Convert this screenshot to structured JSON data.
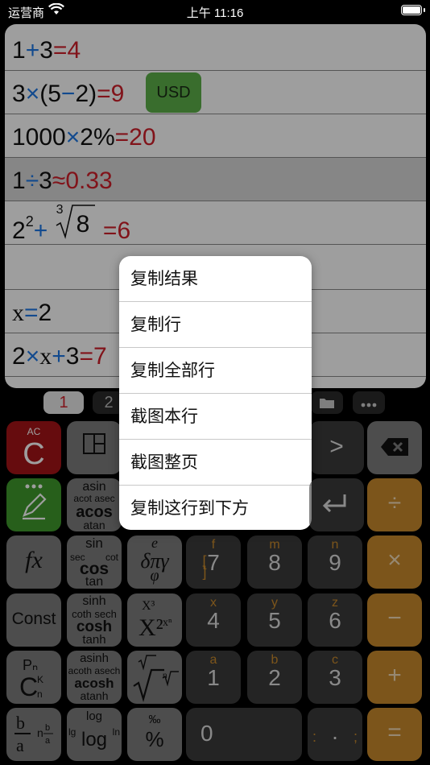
{
  "status": {
    "carrier": "运营商",
    "time": "上午 11:16"
  },
  "lines": [
    {
      "parts": [
        "1",
        "+",
        "3",
        "=",
        "4"
      ]
    },
    {
      "parts": [
        "3",
        "×",
        "(5",
        "−",
        "2)",
        "=",
        "9"
      ],
      "badge": "USD"
    },
    {
      "parts": [
        "1000",
        "×",
        "2%",
        "=",
        "20"
      ]
    },
    {
      "parts": [
        "1",
        "÷",
        "3",
        "≈",
        "0.33"
      ],
      "highlight": true
    },
    {
      "parts": [
        "2",
        "2",
        "+",
        "3",
        "8",
        "=",
        "6"
      ]
    },
    {
      "parts": []
    },
    {
      "parts": [
        "x",
        "=",
        "2"
      ]
    },
    {
      "parts": [
        "2",
        "×",
        "x",
        "+",
        "3",
        "=",
        "7"
      ]
    }
  ],
  "tabs": {
    "active": "1",
    "second": "2"
  },
  "menu": {
    "items": [
      "复制结果",
      "复制行",
      "复制全部行",
      "截图本行",
      "截图整页",
      "复制这行到下方"
    ]
  },
  "keys": {
    "ac": {
      "small": "AC",
      "main": "C"
    },
    "asin": {
      "top": "asin",
      "mid": "acot asec",
      "main": "acos",
      "bot": "atan"
    },
    "sin": {
      "top": "sin",
      "left": "sec",
      "right": "cot",
      "main": "cos",
      "bot": "tan"
    },
    "fx": {
      "main": "fx"
    },
    "greek": {
      "top": "e",
      "main": "δπγ",
      "bot": "φ"
    },
    "sinh": {
      "top": "sinh",
      "mid": "coth sech",
      "main": "cosh",
      "bot": "tanh"
    },
    "const": {
      "main": "Const"
    },
    "asinh": {
      "top": "asinh",
      "mid": "acoth asech",
      "main": "acosh",
      "bot": "atanh"
    },
    "perm": {
      "top": "P",
      "main": "C",
      "sup": "K",
      "sub": "n"
    },
    "frac": {
      "main": "b/a"
    },
    "log": {
      "top": "log",
      "main": "log",
      "left": "lg",
      "right": "ln"
    },
    "percent": {
      "top": "‰",
      "main": "%"
    },
    "num7": {
      "top": "f",
      "main": "7",
      "bracket": "[ ]"
    },
    "num8": {
      "top": "m",
      "main": "8"
    },
    "num9": {
      "top": "n",
      "main": "9"
    },
    "num4": {
      "top": "x",
      "main": "4"
    },
    "num5": {
      "top": "y",
      "main": "5"
    },
    "num6": {
      "top": "z",
      "main": "6"
    },
    "num1": {
      "top": "a",
      "main": "1"
    },
    "num2": {
      "top": "b",
      "main": "2"
    },
    "num3": {
      "top": "c",
      "main": "3"
    },
    "num0": {
      "main": "0"
    },
    "colon": {
      "left": ":",
      "right": ";",
      "main": "."
    },
    "div": {
      "main": "÷"
    },
    "mul": {
      "main": "×"
    },
    "minus": {
      "main": "−"
    },
    "plus": {
      "main": "+"
    },
    "equals": {
      "main": "="
    },
    "right_arrow": {
      "main": ">"
    }
  }
}
